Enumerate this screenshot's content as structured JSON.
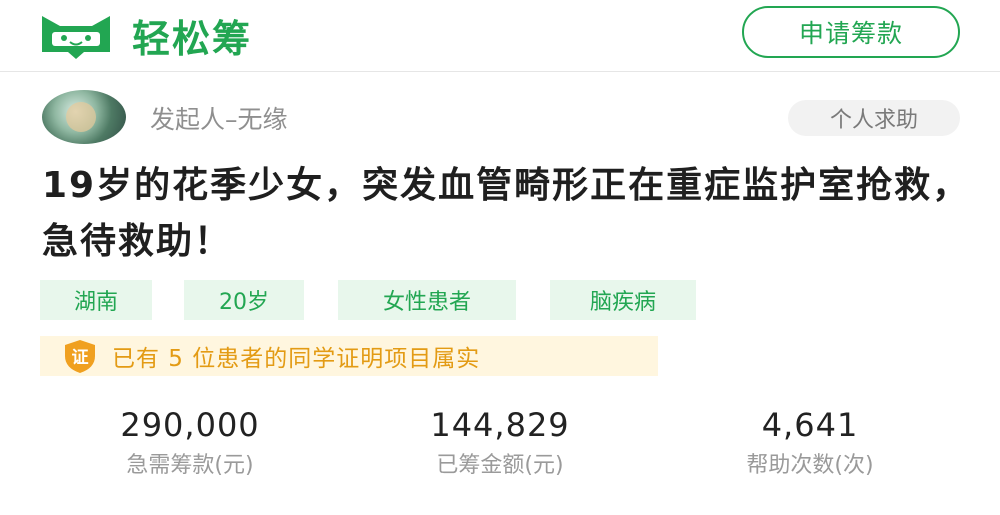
{
  "header": {
    "logo_text": "轻松筹",
    "logo_icon": "cat-face-icon",
    "apply_button": "申请筹款",
    "brand_color": "#22a652"
  },
  "initiator": {
    "label": "发起人–无缘",
    "category": "个人求助"
  },
  "title": "19岁的花季少女，突发血管畸形正在重症监护室抢救，急待救助！",
  "tags": [
    "湖南",
    "20岁",
    "女性患者",
    "脑疾病"
  ],
  "verification": {
    "badge": "证",
    "text": "已有 5 位患者的同学证明项目属实",
    "color": "#e39b14"
  },
  "stats": [
    {
      "value": "290,000",
      "label": "急需筹款(元)"
    },
    {
      "value": "144,829",
      "label": "已筹金额(元)"
    },
    {
      "value": "4,641",
      "label": "帮助次数(次)"
    }
  ]
}
